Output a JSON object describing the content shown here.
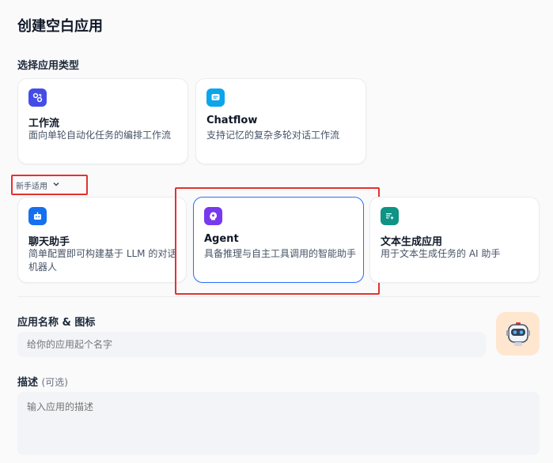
{
  "page": {
    "title": "创建空白应用"
  },
  "app_type": {
    "label": "选择应用类型",
    "cards": [
      {
        "name": "工作流",
        "desc": "面向单轮自动化任务的编排工作流",
        "icon": "workflow-icon",
        "color": "#444ce7"
      },
      {
        "name": "Chatflow",
        "desc": "支持记忆的复杂多轮对话工作流",
        "icon": "chatflow-icon",
        "color": "#0ba5ec"
      }
    ]
  },
  "beginner": {
    "label": "新手适用"
  },
  "beginner_cards": [
    {
      "name": "聊天助手",
      "desc": "简单配置即可构建基于 LLM 的对话机器人",
      "icon": "chat-bot-icon",
      "color": "#1570ef"
    },
    {
      "name": "Agent",
      "desc": "具备推理与自主工具调用的智能助手",
      "icon": "agent-icon",
      "color": "#7839ee",
      "selected": true
    },
    {
      "name": "文本生成应用",
      "desc": "用于文本生成任务的 AI 助手",
      "icon": "text-generation-icon",
      "color": "#0e9384"
    }
  ],
  "name_field": {
    "label": "应用名称 & 图标",
    "placeholder": "给你的应用起个名字",
    "avatar": "robot-avatar-icon"
  },
  "description": {
    "label": "描述",
    "optional": "(可选)",
    "placeholder": "输入应用的描述"
  },
  "colors": {
    "accent": "#2970ff",
    "highlight": "#e5322d"
  }
}
